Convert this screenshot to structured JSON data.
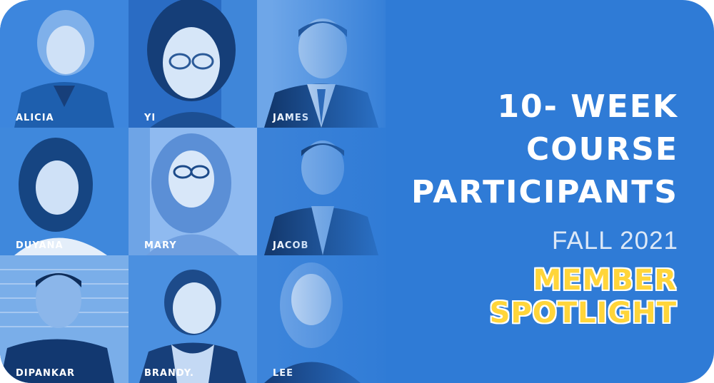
{
  "banner": {
    "title_line1": "10- WEEK COURSE",
    "title_line2": "PARTICIPANTS",
    "season": "FALL 2021",
    "spotlight": "MEMBER SPOTLIGHT"
  },
  "participants": [
    {
      "name": "ALICIA"
    },
    {
      "name": "YI"
    },
    {
      "name": "JAMES"
    },
    {
      "name": "DUYANA"
    },
    {
      "name": "MARY"
    },
    {
      "name": "JACOB"
    },
    {
      "name": "DIPANKAR"
    },
    {
      "name": "BRANDY."
    },
    {
      "name": "LEE"
    }
  ],
  "colors": {
    "background": "#2f7bd6",
    "title": "#ffffff",
    "season": "#dce8f7",
    "spotlight": "#ffd53a",
    "spotlight_outline": "#ffffff"
  }
}
